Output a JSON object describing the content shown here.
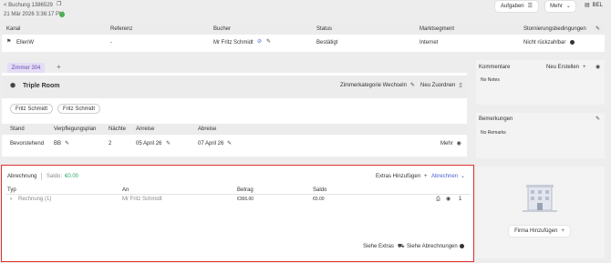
{
  "header": {
    "back_link": "< Buchung 1386529",
    "timestamp": "21 Mär 2026 3:36:17 PM",
    "buttons": {
      "aufgaben": "Aufgaben",
      "mehr": "Mehr",
      "bel": "BEL"
    }
  },
  "booking_table": {
    "columns": [
      "Kanal",
      "Referenz",
      "Bucher",
      "Status",
      "Marktsegment",
      "Stornierungsbedingungen"
    ],
    "row": {
      "kanal": "EllenW",
      "referenz": "-",
      "bucher": "Mr Fritz Schmidt",
      "status": "Bestätigt",
      "marktsegment": "Internet",
      "storno": "Nicht rückzahlbar"
    }
  },
  "room": {
    "tab_label": "Zimmer 304",
    "add_tab": "+",
    "room_type": "Triple Room",
    "change_category": "Zimmerkategorie Wechseln",
    "assign_new": "Neu Zuordnen",
    "guests": [
      "Fritz Schmidt",
      "Fritz Schmidt"
    ],
    "columns": [
      "Stand",
      "Verpflegungsplan",
      "Nächte",
      "Anreise",
      "Abreise"
    ],
    "row": {
      "stand": "Bevorstehend",
      "plan": "BB",
      "naechte": "2",
      "anreise": "05 April 26",
      "abreise": "07 April 26"
    },
    "mehr": "Mehr"
  },
  "billing": {
    "label": "Abrechnung",
    "saldo_label": "Saldo:",
    "saldo_value": "€0.00",
    "add_extras": "Extras Hinzufügen",
    "abrechnen": "Abrechnen",
    "columns": [
      "Typ",
      "An",
      "Betrag",
      "Saldo"
    ],
    "row": {
      "typ": "Rechnung (1)",
      "an": "Mr Fritz Schmidt",
      "betrag": "€366.00",
      "saldo": "€0.00",
      "count": "1"
    },
    "see_extras": "Siehe Extras",
    "see_billing": "Siehe Abrechnungen"
  },
  "sidebar": {
    "comments_title": "Kommentare",
    "new_create": "Neu Erstellen",
    "no_notes": "No Notes",
    "remarks_title": "Bemerkungen",
    "no_remarks": "No Remarks",
    "add_company": "Firma Hinzufügen"
  },
  "colors": {
    "highlight": "#e03030",
    "tab_accent": "#6b4db3",
    "status_green": "#2aa66a",
    "link_blue": "#4a5fd0"
  }
}
